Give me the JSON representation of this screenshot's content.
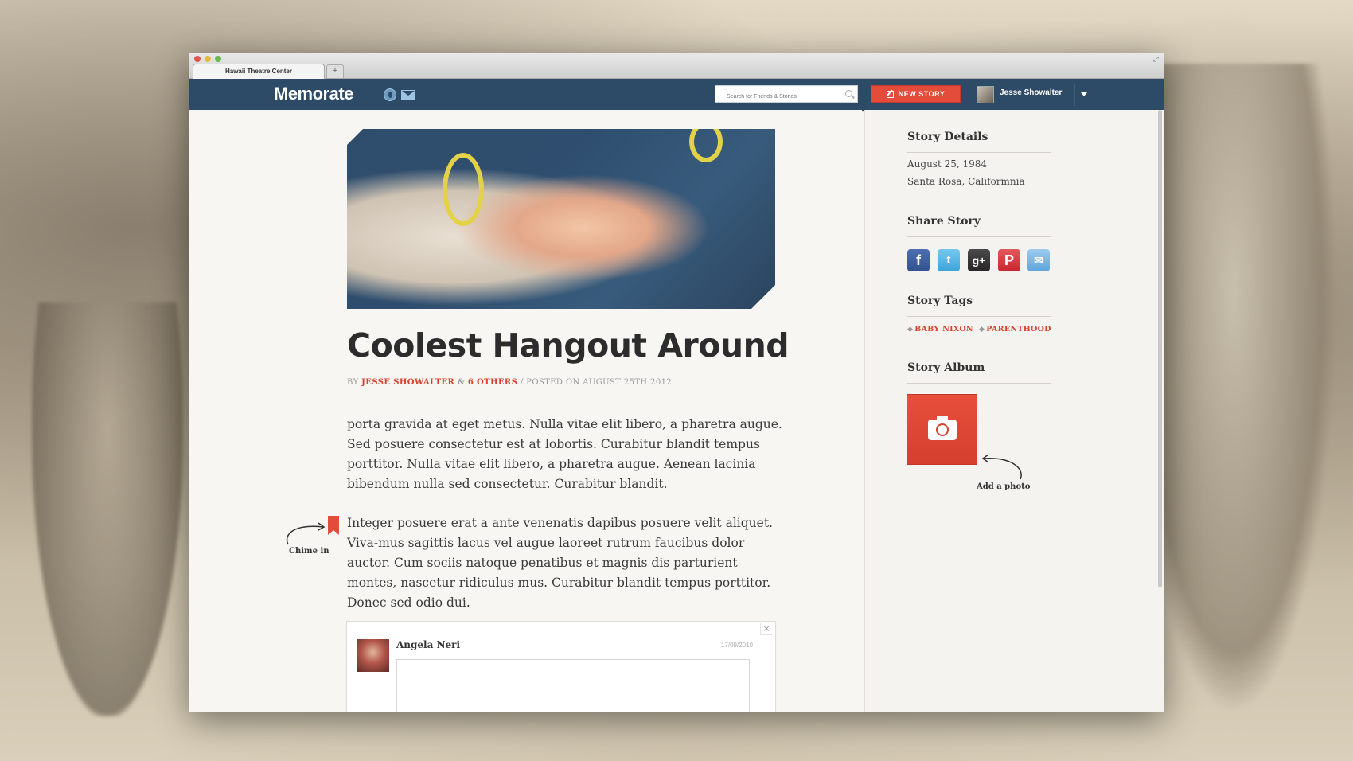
{
  "browser": {
    "tab_title": "Hawaii Theatre Center",
    "new_tab_symbol": "+"
  },
  "navbar": {
    "logo": "Memorate",
    "search_placeholder": "Search for Friends & Stories",
    "new_story_label": "NEW STORY",
    "user_name": "Jesse Showalter",
    "icons": [
      "globe-icon",
      "envelope-icon",
      "search-icon",
      "pencil-icon",
      "chevron-down-icon"
    ]
  },
  "story": {
    "title": "Coolest Hangout Around",
    "byline": {
      "by": "BY",
      "author": "JESSE SHOWALTER",
      "amp": "&",
      "others": "6 OTHERS",
      "sep": "/",
      "posted": "POSTED ON AUGUST 25TH 2012"
    },
    "paragraphs": [
      "porta gravida at eget metus. Nulla vitae elit libero, a pharetra augue. Sed posuere consectetur est at lobortis. Curabitur blandit tempus porttitor. Nulla vitae elit libero, a pharetra augue. Aenean lacinia bibendum nulla sed consectetur. Curabitur blandit.",
      "Integer posuere erat a ante venenatis dapibus posuere velit aliquet. Viva-mus sagittis lacus vel augue laoreet rutrum faucibus dolor auctor. Cum sociis natoque penatibus et magnis dis parturient montes, nascetur ridiculus mus. Curabitur blandit tempus porttitor. Donec sed odio dui."
    ],
    "chime_label": "Chime in"
  },
  "comment": {
    "name": "Angela Neri",
    "date": "17/09/2010",
    "close_symbol": "×"
  },
  "sidebar": {
    "details_heading": "Story Details",
    "date": "August 25, 1984",
    "location": "Santa Rosa, Califormnia",
    "share_heading": "Share Story",
    "share_buttons": [
      {
        "name": "facebook",
        "glyph": "f"
      },
      {
        "name": "twitter",
        "glyph": "t"
      },
      {
        "name": "google-plus",
        "glyph": "g+"
      },
      {
        "name": "pinterest",
        "glyph": "P"
      },
      {
        "name": "email",
        "glyph": "✉"
      }
    ],
    "tags_heading": "Story Tags",
    "tags": [
      "BABY NIXON",
      "PARENTHOOD"
    ],
    "album_heading": "Story Album",
    "add_photo_label": "Add a photo"
  },
  "colors": {
    "navbar": "#2d4a66",
    "accent": "#e34b3a",
    "link_red": "#d9402d"
  }
}
